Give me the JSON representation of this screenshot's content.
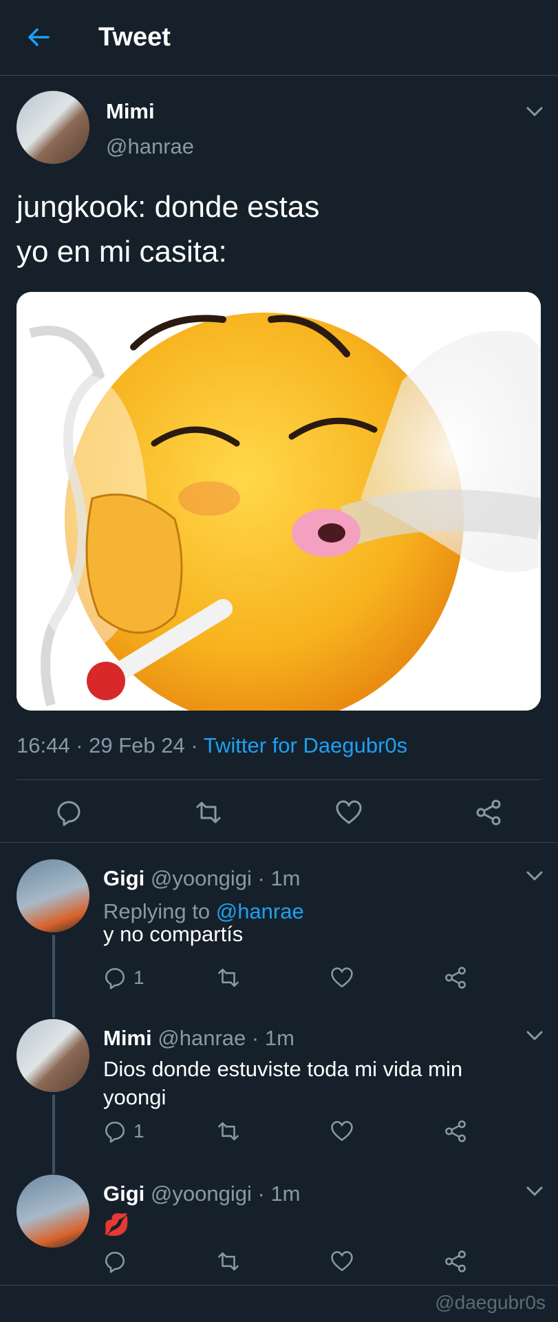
{
  "header": {
    "title": "Tweet"
  },
  "main_tweet": {
    "name": "Mimi",
    "handle": "@hanrae",
    "text_line1": "jungkook: donde estas",
    "text_line2": "yo en mi casita:",
    "time": "16:44",
    "date": "29 Feb 24",
    "separator": "·",
    "source": "Twitter for Daegubr0s"
  },
  "replies": [
    {
      "name": "Gigi",
      "handle": "@yoongigi",
      "time": "1m",
      "separator": "·",
      "replying_prefix": "Replying to",
      "replying_mention": "@hanrae",
      "text": "y no compartís",
      "reply_count": "1"
    },
    {
      "name": "Mimi",
      "handle": "@hanrae",
      "time": "1m",
      "separator": "·",
      "text": "Dios donde estuviste toda mi vida min yoongi",
      "reply_count": "1"
    },
    {
      "name": "Gigi",
      "handle": "@yoongigi",
      "time": "1m",
      "separator": "·",
      "text": "💋"
    }
  ],
  "watermark": "@daegubr0s",
  "colors": {
    "background": "#15202b",
    "accent": "#1da1f2",
    "secondary_text": "#8899a6",
    "divider": "#38444d"
  },
  "icons": {
    "back": "arrow-left-icon",
    "caret": "chevron-down-icon",
    "reply": "speech-bubble-icon",
    "retweet": "retweet-icon",
    "like": "heart-icon",
    "share": "share-nodes-icon"
  }
}
